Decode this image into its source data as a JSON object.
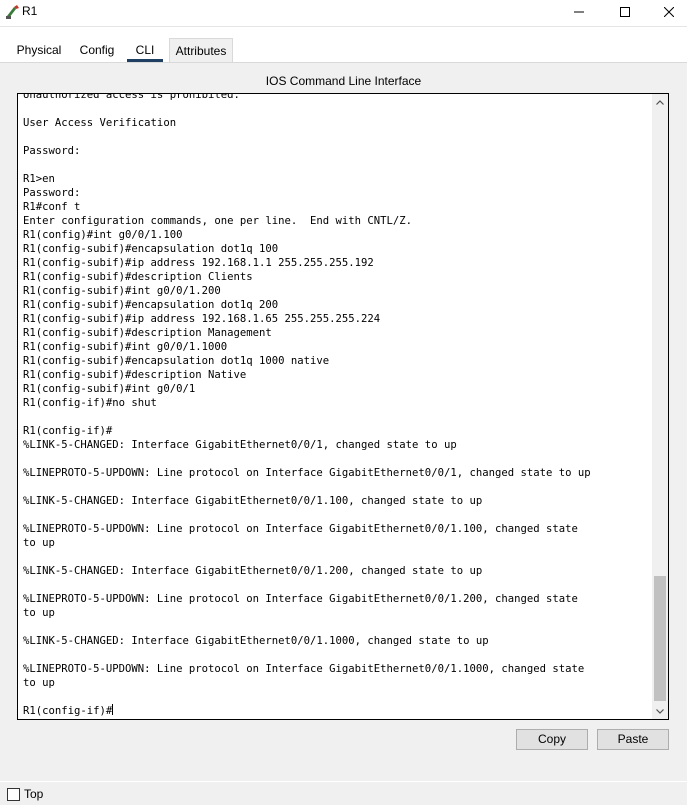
{
  "window": {
    "title": "R1",
    "icon": "router-icon"
  },
  "tabs": [
    {
      "label": "Physical",
      "active": false
    },
    {
      "label": "Config",
      "active": false
    },
    {
      "label": "CLI",
      "active": true
    },
    {
      "label": "Attributes",
      "active": false
    }
  ],
  "panel": {
    "title": "IOS Command Line Interface"
  },
  "terminal": {
    "text": "Unauthorized access is prohibited.\n\nUser Access Verification\n\nPassword:\n\nR1>en\nPassword:\nR1#conf t\nEnter configuration commands, one per line.  End with CNTL/Z.\nR1(config)#int g0/0/1.100\nR1(config-subif)#encapsulation dot1q 100\nR1(config-subif)#ip address 192.168.1.1 255.255.255.192\nR1(config-subif)#description Clients\nR1(config-subif)#int g0/0/1.200\nR1(config-subif)#encapsulation dot1q 200\nR1(config-subif)#ip address 192.168.1.65 255.255.255.224\nR1(config-subif)#description Management\nR1(config-subif)#int g0/0/1.1000\nR1(config-subif)#encapsulation dot1q 1000 native\nR1(config-subif)#description Native\nR1(config-subif)#int g0/0/1\nR1(config-if)#no shut\n\nR1(config-if)#\n%LINK-5-CHANGED: Interface GigabitEthernet0/0/1, changed state to up\n\n%LINEPROTO-5-UPDOWN: Line protocol on Interface GigabitEthernet0/0/1, changed state to up\n\n%LINK-5-CHANGED: Interface GigabitEthernet0/0/1.100, changed state to up\n\n%LINEPROTO-5-UPDOWN: Line protocol on Interface GigabitEthernet0/0/1.100, changed state\nto up\n\n%LINK-5-CHANGED: Interface GigabitEthernet0/0/1.200, changed state to up\n\n%LINEPROTO-5-UPDOWN: Line protocol on Interface GigabitEthernet0/0/1.200, changed state\nto up\n\n%LINK-5-CHANGED: Interface GigabitEthernet0/0/1.1000, changed state to up\n\n%LINEPROTO-5-UPDOWN: Line protocol on Interface GigabitEthernet0/0/1.1000, changed state\nto up\n\n",
    "prompt": "R1(config-if)#"
  },
  "buttons": {
    "copy": "Copy",
    "paste": "Paste"
  },
  "footer": {
    "top_label": "Top",
    "top_checked": false
  },
  "colors": {
    "active_tab_underline": "#1f3f63",
    "terminal_bg": "#ffffff",
    "window_bg": "#f0f0f0"
  }
}
